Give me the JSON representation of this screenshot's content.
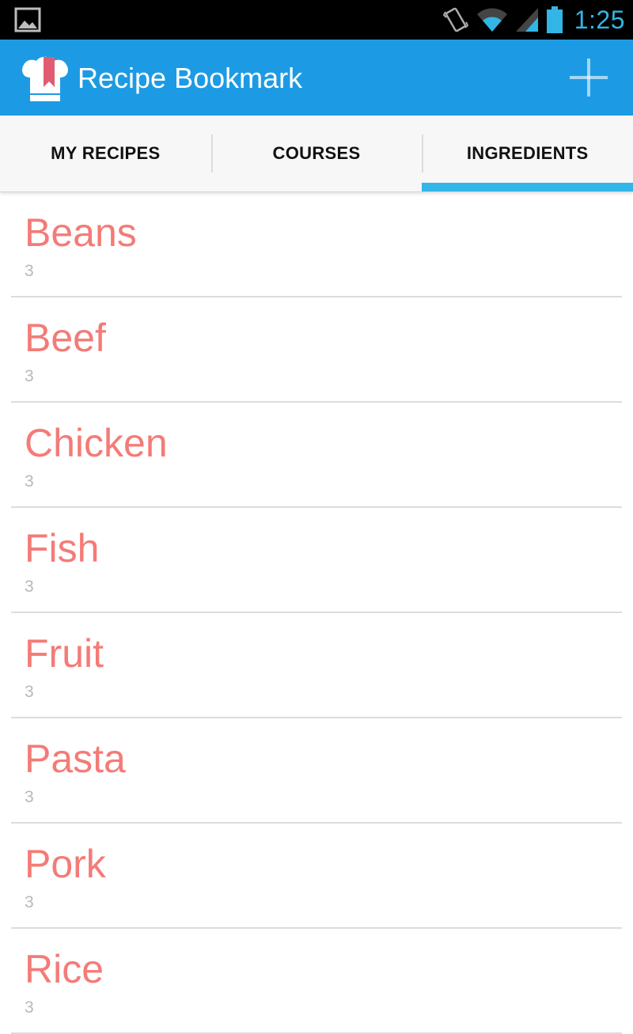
{
  "status_bar": {
    "time": "1:25",
    "icons": [
      "gallery-notification-icon",
      "vibrate-icon",
      "wifi-icon",
      "cell-signal-icon",
      "battery-icon"
    ],
    "accent_color": "#33b5e5"
  },
  "action_bar": {
    "title": "Recipe Bookmark",
    "background_color": "#1c9be4",
    "logo_icon": "chef-hat-bookmark-icon",
    "add_icon": "plus-icon"
  },
  "tabs": [
    {
      "label": "MY RECIPES",
      "active": false
    },
    {
      "label": "COURSES",
      "active": false
    },
    {
      "label": "INGREDIENTS",
      "active": true
    }
  ],
  "ingredients": [
    {
      "name": "Beans",
      "count": "3"
    },
    {
      "name": "Beef",
      "count": "3"
    },
    {
      "name": "Chicken",
      "count": "3"
    },
    {
      "name": "Fish",
      "count": "3"
    },
    {
      "name": "Fruit",
      "count": "3"
    },
    {
      "name": "Pasta",
      "count": "3"
    },
    {
      "name": "Pork",
      "count": "3"
    },
    {
      "name": "Rice",
      "count": "3"
    }
  ],
  "colors": {
    "item_name": "#f47b77",
    "item_count": "#b8b8b8",
    "tab_indicator": "#33b5e5"
  }
}
